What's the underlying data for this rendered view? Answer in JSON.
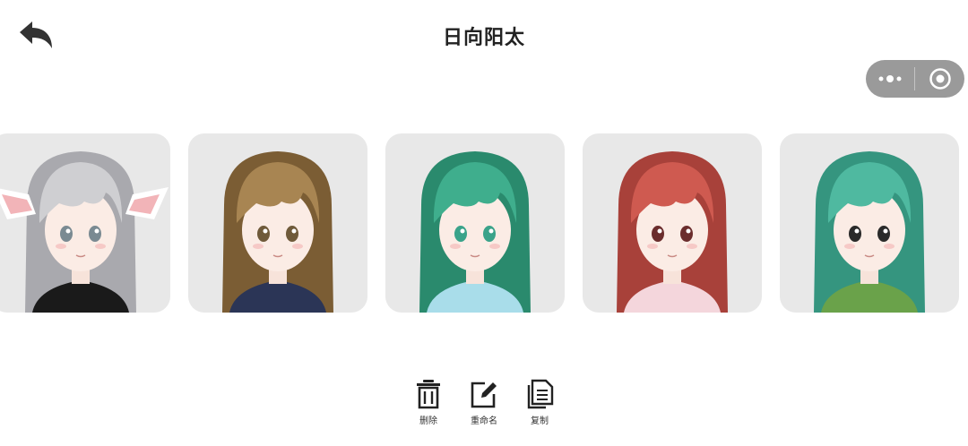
{
  "header": {
    "title": "日向阳太"
  },
  "capsule": {
    "more_icon": "more-dots-icon",
    "close_icon": "target-circle-icon"
  },
  "avatars": [
    {
      "hair": "#cfcfd2",
      "hair_dark": "#a9a9ae",
      "eyes": "#7a8a92",
      "outfit": "#1a1a1a",
      "ears": "#f2b4b8"
    },
    {
      "hair": "#a88552",
      "hair_dark": "#7b5d34",
      "eyes": "#6f5a3a",
      "outfit": "#2b3556"
    },
    {
      "hair": "#3fae8d",
      "hair_dark": "#2a8a6d",
      "eyes": "#3aa38a",
      "outfit": "#a9ddea"
    },
    {
      "hair": "#cf5a50",
      "hair_dark": "#a8413a",
      "eyes": "#6b2d2d",
      "outfit": "#f4d6dc"
    },
    {
      "hair": "#4fb9a0",
      "hair_dark": "#35957f",
      "eyes": "#2a2a2a",
      "outfit": "#6aa24a"
    }
  ],
  "toolbar": {
    "delete_label": "删除",
    "rename_label": "重命名",
    "copy_label": "复制"
  }
}
